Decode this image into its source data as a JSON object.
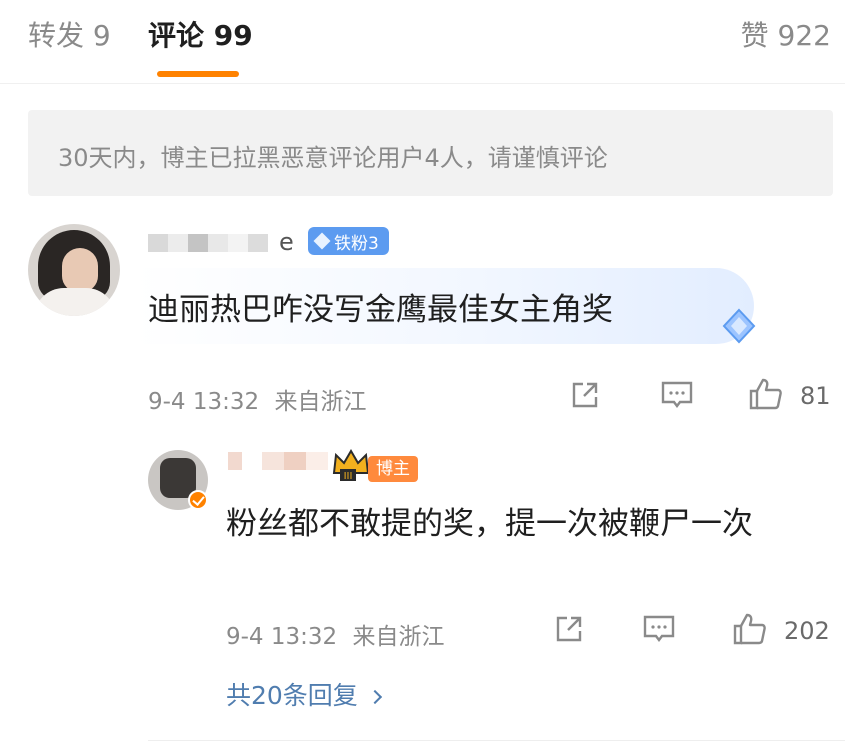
{
  "tabs": {
    "forward": "转发 9",
    "comment": "评论 99",
    "like": "赞 922"
  },
  "notice": "30天内，博主已拉黑恶意评论用户4人，请谨慎评论",
  "comment": {
    "username_visible": "e",
    "fan_badge": "铁粉3",
    "text": "迪丽热巴咋没写金鹰最佳女主角奖",
    "time": "9-4 13:32",
    "location": "来自浙江",
    "like_count": "81",
    "icons": [
      "share-icon",
      "comment-icon",
      "like-icon"
    ]
  },
  "reply": {
    "host_badge": "博主",
    "text": "粉丝都不敢提的奖，提一次被鞭尸一次",
    "time": "9-4 13:32",
    "location": "来自浙江",
    "like_count": "202",
    "icons": [
      "share-icon",
      "comment-icon",
      "like-icon"
    ]
  },
  "more_replies": "共20条回复",
  "colors": {
    "accent": "#ff8200",
    "link": "#507daf",
    "fan_badge": "#5c9bf0",
    "host_badge": "#ff8a3d"
  }
}
